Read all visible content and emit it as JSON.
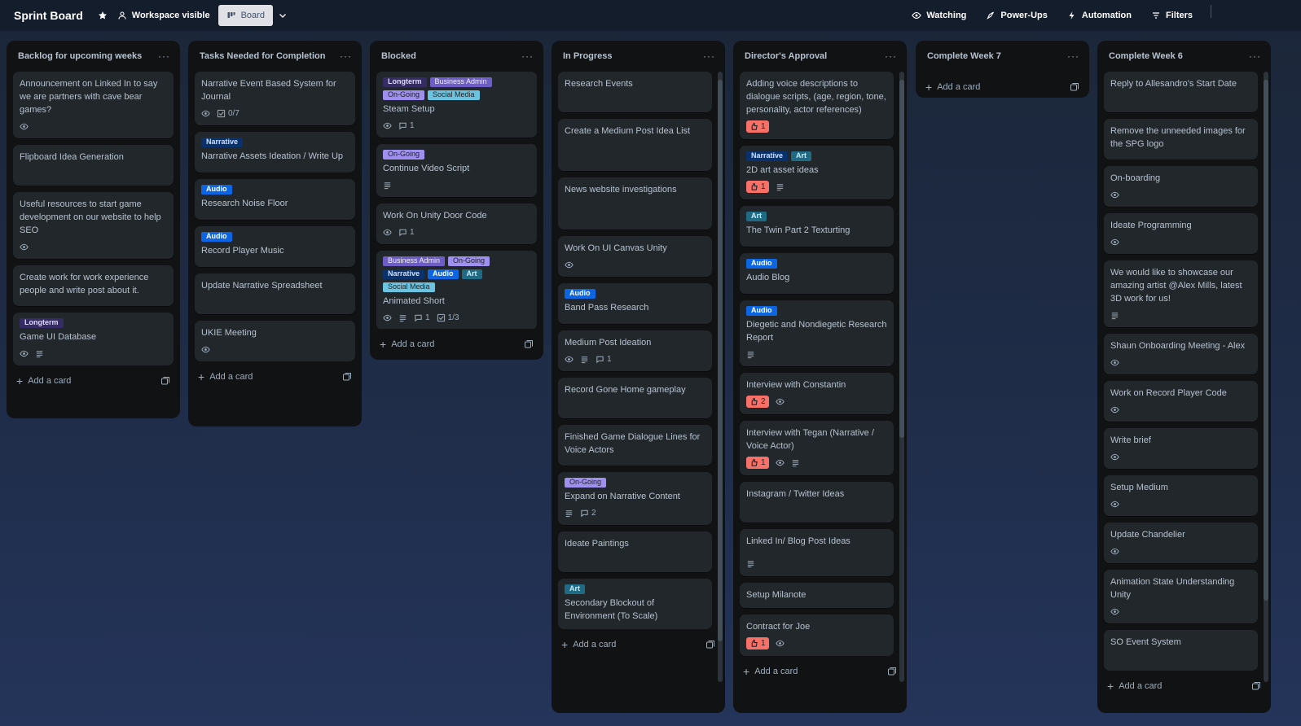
{
  "header": {
    "title": "Sprint Board",
    "visibility": "Workspace visible",
    "view": "Board",
    "watching": "Watching",
    "powerups": "Power-Ups",
    "automation": "Automation",
    "filters": "Filters"
  },
  "add_card_label": "Add a card",
  "colors": {
    "longterm": "#352c63",
    "business_admin": "#6e5dc6",
    "on_going": "#9f8fef",
    "social_media": "#6cc3e0",
    "narrative": "#09326c",
    "audio": "#0c66e4",
    "art": "#206a83",
    "vote": "#f87168",
    "card": "#22272b",
    "list": "#111214"
  },
  "lists": [
    {
      "title": "Backlog for upcoming weeks",
      "cards": [
        {
          "title": "Announcement on Linked In to say we are partners with cave bear games?",
          "labels": [],
          "badges": [
            {
              "type": "watch"
            }
          ]
        },
        {
          "title": "Flipboard Idea Generation",
          "labels": [],
          "badges": [],
          "tall": true
        },
        {
          "title": "Useful resources to start game development on our website to help SEO",
          "labels": [],
          "badges": [
            {
              "type": "watch"
            }
          ]
        },
        {
          "title": "Create work for work experience people and write post about it.",
          "labels": [],
          "badges": [],
          "tall": true
        },
        {
          "title": "Game UI Database",
          "labels": [
            {
              "text": "Longterm",
              "cls": "lbl-longterm"
            }
          ],
          "badges": [
            {
              "type": "watch"
            },
            {
              "type": "desc"
            }
          ]
        }
      ]
    },
    {
      "title": "Tasks Needed for Completion",
      "cards": [
        {
          "title": "Narrative Event Based System for Journal",
          "labels": [],
          "badges": [
            {
              "type": "watch"
            },
            {
              "type": "checklist",
              "text": "0/7"
            }
          ]
        },
        {
          "title": "Narrative Assets Ideation / Write Up",
          "labels": [
            {
              "text": "Narrative",
              "cls": "lbl-narrative"
            }
          ],
          "badges": [],
          "tall": true
        },
        {
          "title": "Research Noise Floor",
          "labels": [
            {
              "text": "Audio",
              "cls": "lbl-audio"
            }
          ],
          "badges": [],
          "tall": true
        },
        {
          "title": "Record Player Music",
          "labels": [
            {
              "text": "Audio",
              "cls": "lbl-audio"
            }
          ],
          "badges": [],
          "tall": true
        },
        {
          "title": "Update Narrative Spreadsheet",
          "labels": [],
          "badges": [],
          "tall": true
        },
        {
          "title": "UKIE Meeting",
          "labels": [],
          "badges": [
            {
              "type": "watch"
            }
          ]
        }
      ]
    },
    {
      "title": "Blocked",
      "cards": [
        {
          "title": "Steam Setup",
          "labels": [
            {
              "text": "Longterm",
              "cls": "lbl-longterm"
            },
            {
              "text": "Business Admin",
              "cls": "lbl-business"
            },
            {
              "text": "On-Going",
              "cls": "lbl-ongoing"
            },
            {
              "text": "Social Media",
              "cls": "lbl-social"
            }
          ],
          "badges": [
            {
              "type": "watch"
            },
            {
              "type": "comment",
              "text": "1"
            }
          ]
        },
        {
          "title": "Continue Video Script",
          "labels": [
            {
              "text": "On-Going",
              "cls": "lbl-ongoing"
            }
          ],
          "badges": [
            {
              "type": "desc"
            }
          ]
        },
        {
          "title": "Work On Unity Door Code",
          "labels": [],
          "badges": [
            {
              "type": "watch"
            },
            {
              "type": "comment",
              "text": "1"
            }
          ]
        },
        {
          "title": "Animated Short",
          "labels": [
            {
              "text": "Business Admin",
              "cls": "lbl-business"
            },
            {
              "text": "On-Going",
              "cls": "lbl-ongoing"
            },
            {
              "text": "Narrative",
              "cls": "lbl-narrative"
            },
            {
              "text": "Audio",
              "cls": "lbl-audio"
            },
            {
              "text": "Art",
              "cls": "lbl-art"
            },
            {
              "text": "Social Media",
              "cls": "lbl-social"
            }
          ],
          "badges": [
            {
              "type": "watch"
            },
            {
              "type": "desc"
            },
            {
              "type": "comment",
              "text": "1"
            },
            {
              "type": "checklist",
              "text": "1/3"
            }
          ]
        }
      ]
    },
    {
      "title": "In Progress",
      "scroll": true,
      "cards": [
        {
          "title": "Research Events",
          "labels": [],
          "badges": [],
          "tall": true
        },
        {
          "title": "Create a Medium Post Idea List",
          "labels": [],
          "badges": [],
          "tall2": true
        },
        {
          "title": "News website investigations",
          "labels": [],
          "badges": [],
          "tall2": true
        },
        {
          "title": "Work On UI Canvas Unity",
          "labels": [],
          "badges": [
            {
              "type": "watch"
            }
          ]
        },
        {
          "title": "Band Pass Research",
          "labels": [
            {
              "text": "Audio",
              "cls": "lbl-audio"
            }
          ],
          "badges": [],
          "tall": true
        },
        {
          "title": "Medium Post Ideation",
          "labels": [],
          "badges": [
            {
              "type": "watch"
            },
            {
              "type": "desc"
            },
            {
              "type": "comment",
              "text": "1"
            }
          ]
        },
        {
          "title": "Record Gone Home gameplay",
          "labels": [],
          "badges": [],
          "tall": true
        },
        {
          "title": "Finished Game Dialogue Lines for Voice Actors",
          "labels": [],
          "badges": [],
          "tall": true
        },
        {
          "title": "Expand on Narrative Content",
          "labels": [
            {
              "text": "On-Going",
              "cls": "lbl-ongoing"
            }
          ],
          "badges": [
            {
              "type": "desc"
            },
            {
              "type": "comment",
              "text": "2"
            }
          ]
        },
        {
          "title": "Ideate Paintings",
          "labels": [],
          "badges": [],
          "tall": true
        },
        {
          "title": "Secondary Blockout of Environment (To Scale)",
          "labels": [
            {
              "text": "Art",
              "cls": "lbl-art"
            }
          ],
          "badges": [],
          "tall": true
        }
      ]
    },
    {
      "title": "Director's Approval",
      "scroll": true,
      "cards": [
        {
          "title": "Adding voice descriptions to dialogue scripts, (age, region, tone, personality, actor references)",
          "labels": [],
          "badges": [
            {
              "type": "vote",
              "text": "1"
            }
          ]
        },
        {
          "title": "2D art asset ideas",
          "labels": [
            {
              "text": "Narrative",
              "cls": "lbl-narrative"
            },
            {
              "text": "Art",
              "cls": "lbl-art"
            }
          ],
          "badges": [
            {
              "type": "vote",
              "text": "1"
            },
            {
              "type": "desc"
            }
          ]
        },
        {
          "title": "The Twin Part 2 Texturting",
          "labels": [
            {
              "text": "Art",
              "cls": "lbl-art"
            }
          ],
          "badges": [],
          "tall": true
        },
        {
          "title": "Audio Blog",
          "labels": [
            {
              "text": "Audio",
              "cls": "lbl-audio"
            }
          ],
          "badges": [],
          "tall": true
        },
        {
          "title": "Diegetic and Nondiegetic Research Report",
          "labels": [
            {
              "text": "Audio",
              "cls": "lbl-audio"
            }
          ],
          "badges": [
            {
              "type": "desc"
            }
          ]
        },
        {
          "title": "Interview with Constantin",
          "labels": [],
          "badges": [
            {
              "type": "vote",
              "text": "2"
            },
            {
              "type": "watch"
            }
          ]
        },
        {
          "title": "Interview with Tegan (Narrative / Voice Actor)",
          "labels": [],
          "badges": [
            {
              "type": "vote",
              "text": "1"
            },
            {
              "type": "watch"
            },
            {
              "type": "desc"
            }
          ]
        },
        {
          "title": "Instagram / Twitter Ideas",
          "labels": [],
          "badges": [],
          "tall": true
        },
        {
          "title": "Linked In/ Blog Post Ideas",
          "labels": [],
          "badges": [
            {
              "type": "desc"
            }
          ],
          "tallb": true
        },
        {
          "title": "Setup Milanote",
          "labels": [],
          "badges": []
        },
        {
          "title": "Contract for Joe",
          "labels": [],
          "badges": [
            {
              "type": "vote",
              "text": "1"
            },
            {
              "type": "watch"
            }
          ]
        }
      ]
    },
    {
      "title": "Complete Week 7",
      "cards": []
    },
    {
      "title": "Complete Week 6",
      "scroll": true,
      "cards": [
        {
          "title": "Reply to Allesandro's Start Date",
          "labels": [],
          "badges": [],
          "tall": true
        },
        {
          "title": "Remove the unneeded images for the SPG logo",
          "labels": [],
          "badges": [],
          "tall": true
        },
        {
          "title": "On-boarding",
          "labels": [],
          "badges": [
            {
              "type": "watch"
            }
          ]
        },
        {
          "title": "Ideate Programming",
          "labels": [],
          "badges": [
            {
              "type": "watch"
            }
          ]
        },
        {
          "title": "We would like to showcase our amazing artist @Alex Mills, latest 3D work for us!",
          "labels": [],
          "badges": [
            {
              "type": "desc"
            }
          ]
        },
        {
          "title": "Shaun Onboarding Meeting - Alex",
          "labels": [],
          "badges": [
            {
              "type": "watch"
            }
          ]
        },
        {
          "title": "Work on Record Player Code",
          "labels": [],
          "badges": [
            {
              "type": "watch"
            }
          ]
        },
        {
          "title": "Write brief",
          "labels": [],
          "badges": [
            {
              "type": "watch"
            }
          ]
        },
        {
          "title": "Setup Medium",
          "labels": [],
          "badges": [
            {
              "type": "watch"
            }
          ]
        },
        {
          "title": "Update Chandelier",
          "labels": [],
          "badges": [
            {
              "type": "watch"
            }
          ]
        },
        {
          "title": "Animation State Understanding Unity",
          "labels": [],
          "badges": [
            {
              "type": "watch"
            }
          ]
        },
        {
          "title": "SO Event System",
          "labels": [],
          "badges": [],
          "tall": true
        }
      ]
    }
  ]
}
